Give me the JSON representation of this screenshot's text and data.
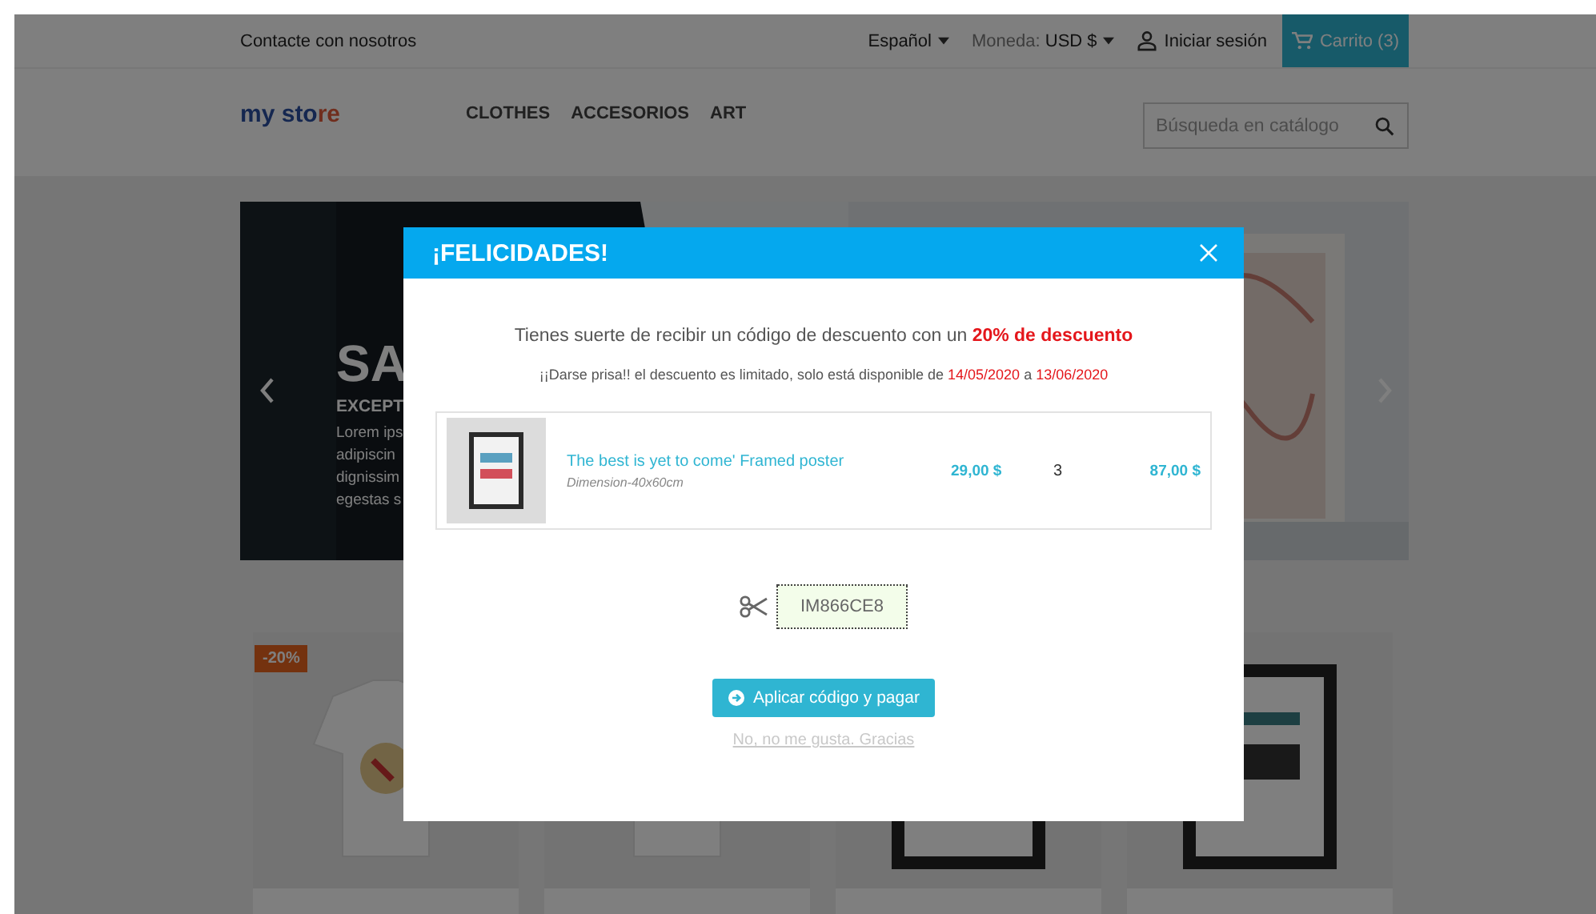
{
  "top_bar": {
    "contact": "Contacte con nosotros",
    "language": "Español",
    "currency_label": "Moneda:",
    "currency": "USD $",
    "sign_in": "Iniciar sesión",
    "cart": "Carrito (3)"
  },
  "header": {
    "logo": "my store",
    "nav": [
      "CLOTHES",
      "ACCESORIOS",
      "ART"
    ],
    "search": {
      "placeholder": "Búsqueda en catálogo"
    }
  },
  "slider": {
    "title": "SA",
    "subtitle": "EXCEPT",
    "lines": [
      "Lorem ips",
      "adipiscin",
      "dignissim",
      "egestas s"
    ]
  },
  "products": [
    {
      "kind": "shirt",
      "badge": "-20%"
    },
    {
      "kind": "shirt"
    },
    {
      "kind": "poster"
    },
    {
      "kind": "poster"
    }
  ],
  "modal": {
    "title": "¡FELICIDADES!",
    "message": [
      {
        "text": "Tienes suerte de recibir un código de descuento con un ",
        "highlight": false
      },
      {
        "text": "20% de descuento",
        "highlight": true
      }
    ],
    "notice": [
      {
        "text": "¡¡Darse prisa!! el descuento es limitado, solo está disponible de ",
        "highlight": false
      },
      {
        "text": "14/05/2020",
        "highlight": true
      },
      {
        "text": " a ",
        "highlight": false
      },
      {
        "text": "13/06/2020",
        "highlight": true
      }
    ],
    "item": {
      "name": "The best is yet to come' Framed poster",
      "attribute": "Dimension-40x60cm",
      "price": "29,00 $",
      "quantity": "3",
      "total": "87,00 $"
    },
    "code": "IM866CE8",
    "apply_button": "Aplicar código y pagar",
    "decline_link": "No, no me gusta. Gracias"
  }
}
